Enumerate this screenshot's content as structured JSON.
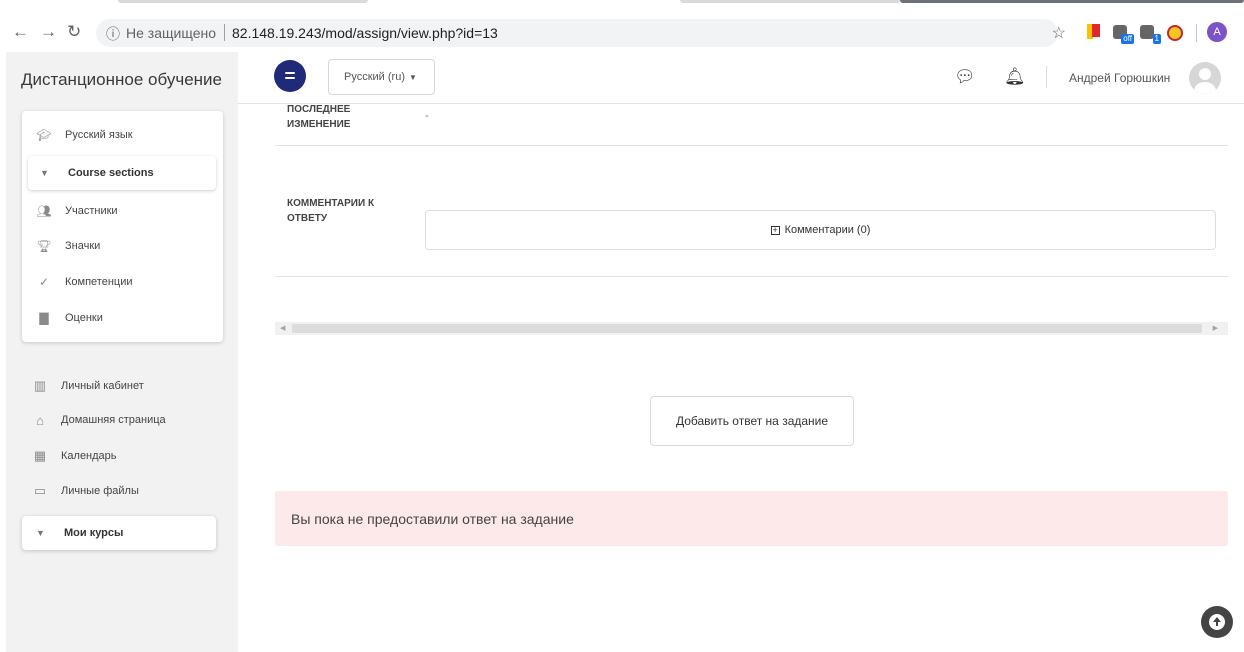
{
  "browser": {
    "security_label": "Не защищено",
    "url": "82.148.19.243/mod/assign/view.php?id=13",
    "ext_tag_1": "off",
    "ext_tag_2": "1",
    "profile_initial": "A"
  },
  "site": {
    "title": "Дистанционное обучение"
  },
  "course_nav": {
    "course": "Русский язык",
    "sections_toggle": "Course sections",
    "items": [
      {
        "label": "Участники",
        "icon": "users-icon"
      },
      {
        "label": "Значки",
        "icon": "trophy-icon"
      },
      {
        "label": "Компетенции",
        "icon": "check-icon"
      },
      {
        "label": "Оценки",
        "icon": "grades-book-icon"
      }
    ]
  },
  "site_nav": {
    "items": [
      {
        "label": "Личный кабинет",
        "icon": "dashboard-icon"
      },
      {
        "label": "Домашняя страница",
        "icon": "home-icon"
      },
      {
        "label": "Календарь",
        "icon": "calendar-icon"
      },
      {
        "label": "Личные файлы",
        "icon": "files-drive-icon"
      }
    ],
    "my_courses": "Мои курсы"
  },
  "header": {
    "language": "Русский (ru)",
    "user_name": "Андрей Горюшкин"
  },
  "submission": {
    "last_modified_label": "Последнее изменение",
    "last_modified_value": "-",
    "comments_label": "Комментарии к ответу",
    "comments_button": "Комментарии (0)",
    "add_submission_button": "Добавить ответ на задание",
    "status_alert": "Вы пока не предоставили ответ на задание"
  },
  "colors": {
    "accent": "#1f2a78",
    "alert_bg": "#fde8ea",
    "drawer_bg": "#f2f2f2"
  }
}
